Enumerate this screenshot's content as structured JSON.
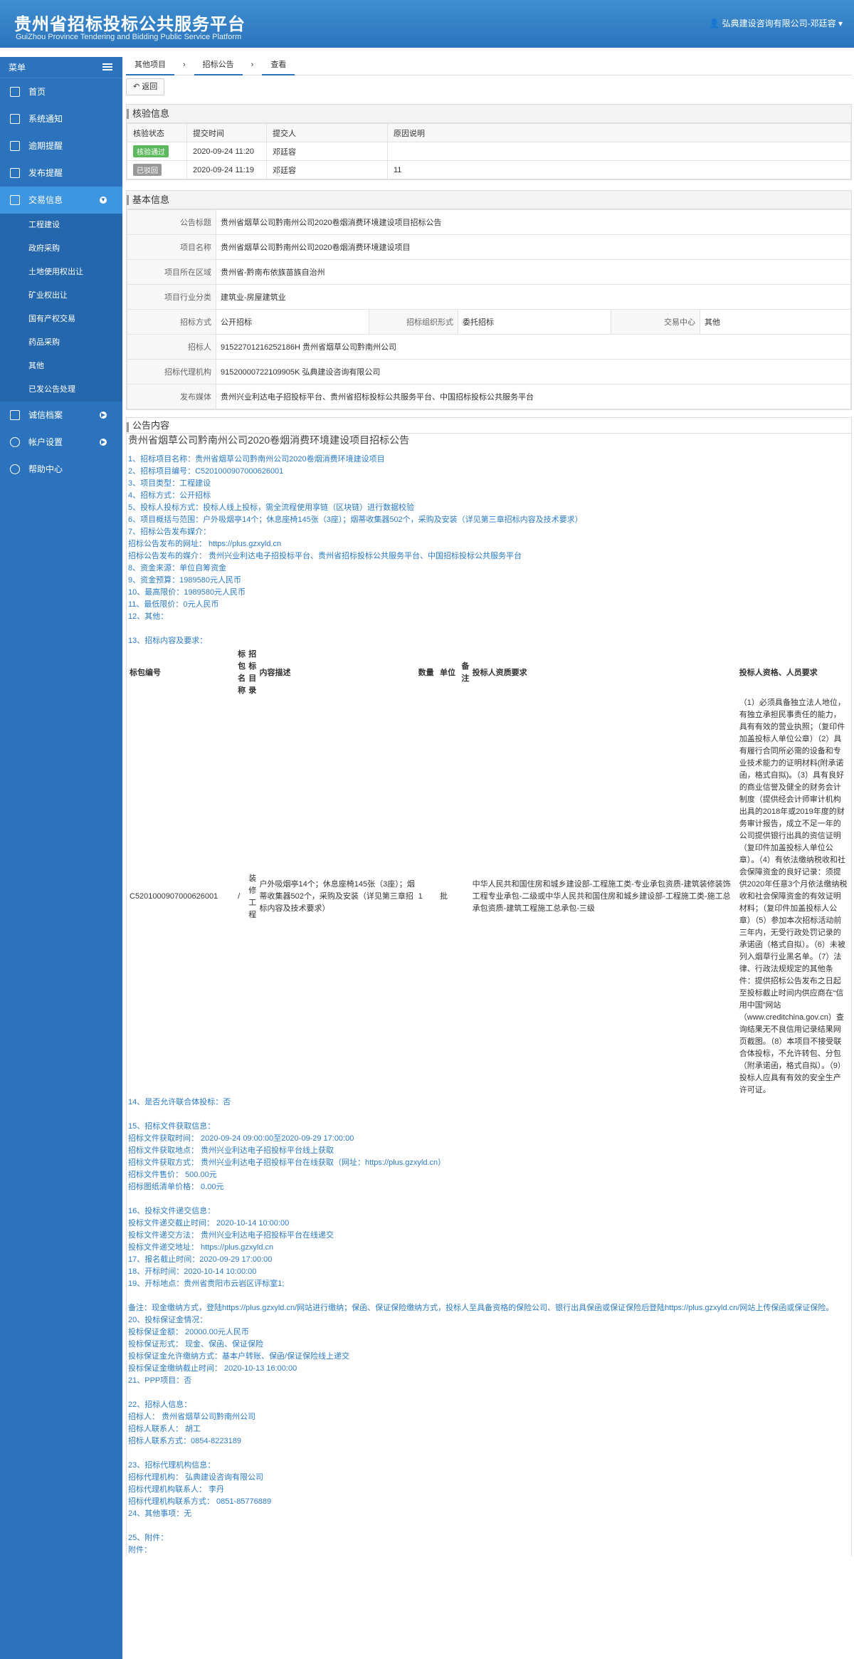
{
  "header": {
    "title_cn": "贵州省招标投标公共服务平台",
    "title_en": "GuiZhou Province Tendering and Bidding Public Service Platform",
    "user": "弘典建设咨询有限公司-邓廷容 ▾"
  },
  "sidebar": {
    "menu_label": "菜单",
    "items": [
      {
        "label": "首页",
        "icon": "home-icon"
      },
      {
        "label": "系统通知",
        "icon": "monitor-icon"
      },
      {
        "label": "逾期提醒",
        "icon": "clock-icon"
      },
      {
        "label": "发布提醒",
        "icon": "bell-icon"
      },
      {
        "label": "交易信息",
        "icon": "file-icon"
      }
    ],
    "sub_items": [
      "工程建设",
      "政府采购",
      "土地使用权出让",
      "矿业权出让",
      "国有产权交易",
      "药品采购",
      "其他",
      "已发公告处理"
    ],
    "bottom_items": [
      {
        "label": "诚信档案",
        "icon": "list-icon"
      },
      {
        "label": "帐户设置",
        "icon": "user-icon"
      },
      {
        "label": "帮助中心",
        "icon": "help-icon"
      }
    ]
  },
  "breadcrumb": [
    "其他项目",
    "招标公告",
    "查看"
  ],
  "back_label": "返回",
  "verify": {
    "title": "核验信息",
    "headers": [
      "核验状态",
      "提交时间",
      "提交人",
      "原因说明"
    ],
    "rows": [
      {
        "status": "核验通过",
        "status_color": "#5cb85c",
        "time": "2020-09-24 11:20",
        "person": "邓廷容",
        "reason": ""
      },
      {
        "status": "已驳回",
        "status_color": "#999999",
        "time": "2020-09-24 11:19",
        "person": "邓廷容",
        "reason": "11"
      }
    ]
  },
  "basic": {
    "title": "基本信息",
    "announce_title_label": "公告标题",
    "announce_title": "贵州省烟草公司黔南州公司2020卷烟消费环境建设项目招标公告",
    "project_label": "项目名称",
    "project": "贵州省烟草公司黔南州公司2020卷烟消费环境建设项目",
    "region_label": "项目所在区域",
    "region": "贵州省-黔南布依族苗族自治州",
    "industry_label": "项目行业分类",
    "industry": "建筑业-房屋建筑业",
    "method_label": "招标方式",
    "method": "公开招标",
    "org_label": "招标组织形式",
    "org": "委托招标",
    "center_label": "交易中心",
    "center": "其他",
    "tenderer_label": "招标人",
    "tenderer": "91522701216252186H 贵州省烟草公司黔南州公司",
    "agency_label": "招标代理机构",
    "agency": "91520000722109905K 弘典建设咨询有限公司",
    "media_label": "发布媒体",
    "media": "贵州兴业利达电子招投标平台、贵州省招标投标公共服务平台、中国招标投标公共服务平台"
  },
  "notice": {
    "section_title": "公告内容",
    "title": "贵州省烟草公司黔南州公司2020卷烟消费环境建设项目招标公告",
    "lines_a": [
      "1、招标项目名称：贵州省烟草公司黔南州公司2020卷烟消费环境建设项目",
      "2、招标项目编号：C5201000907000626001",
      "3、项目类型：工程建设",
      "4、招标方式：公开招标",
      "5、投标人投标方式：投标人线上投标，需全流程使用享链（区块链）进行数据校验",
      "6、项目概括与范围：户外吸烟亭14个；休息座椅145张（3座）；烟蒂收集器502个，采购及安装（详见第三章招标内容及技术要求）",
      "7、招标公告发布媒介：",
      "招标公告发布的网址： https://plus.gzxyld.cn",
      "招标公告发布的媒介： 贵州兴业利达电子招投标平台、贵州省招标投标公共服务平台、中国招标投标公共服务平台",
      "8、资金来源：单位自筹资金",
      "9、资金预算：1989580元人民币",
      "10、最高限价：1989580元人民币",
      "11、最低限价：0元人民币",
      "12、其他：",
      "",
      "13、招标内容及要求："
    ],
    "pkg_headers": [
      "标包编号",
      "标包名称",
      "招标目录",
      "内容描述",
      "数量",
      "单位",
      "备注",
      "投标人资质要求",
      "投标人资格、人员要求"
    ],
    "pkg_row": {
      "code": "C5201000907000626001",
      "name": "/",
      "catalog": "装修工程",
      "desc": "户外吸烟亭14个；休息座椅145张（3座）；烟蒂收集器502个，采购及安装（详见第三章招标内容及技术要求）",
      "qty": "1",
      "unit": "批",
      "remark": "",
      "qual": "中华人民共和国住房和城乡建设部-工程施工类-专业承包资质-建筑装修装饰工程专业承包-二级或中华人民共和国住房和城乡建设部-工程施工类-施工总承包资质-建筑工程施工总承包-三级",
      "staff": "（1）必须具备独立法人地位，有独立承担民事责任的能力，具有有效的营业执照；（复印件加盖投标人单位公章）（2）具有履行合同所必需的设备和专业技术能力的证明材料(附承诺函，格式自拟)。（3）具有良好的商业信誉及健全的财务会计制度（提供经会计师审计机构出具的2018年或2019年度的财务审计报告，成立不足一年的公司提供银行出具的资信证明（复印件加盖投标人单位公章）。（4）有依法缴纳税收和社会保障资金的良好记录：须提供2020年任意3个月依法缴纳税收和社会保障资金的有效证明材料；（复印件加盖投标人公章）（5）参加本次招标活动前三年内，无受行政处罚记录的承诺函（格式自拟）。（6）未被列入烟草行业黑名单。（7）法律、行政法规规定的其他条件：提供招标公告发布之日起至投标截止时间内供应商在“信用中国”网站（www.creditchina.gov.cn）查询结果无不良信用记录结果网页截图。（8）本项目不接受联合体投标，不允许转包、分包（附承诺函，格式自拟）。（9）投标人应具有有效的安全生产许可证。"
    },
    "lines_b": [
      "14、是否允许联合体投标：否",
      "",
      "15、招标文件获取信息：",
      "招标文件获取时间： 2020-09-24 09:00:00至2020-09-29 17:00:00",
      "招标文件获取地点： 贵州兴业利达电子招投标平台线上获取",
      "招标文件获取方式： 贵州兴业利达电子招投标平台在线获取（网址：https://plus.gzxyld.cn）",
      "招标文件售价： 500.00元",
      "招标图纸清单价格： 0.00元",
      "",
      "16、投标文件递交信息：",
      "投标文件递交截止时间： 2020-10-14 10:00:00",
      "投标文件递交方法： 贵州兴业利达电子招投标平台在线递交",
      "投标文件递交地址： https://plus.gzxyld.cn",
      "17、报名截止时间：2020-09-29 17:00:00",
      "18、开标时间：2020-10-14 10:00:00",
      "19、开标地点：贵州省贵阳市云岩区评标室1;",
      "",
      "备注：现金缴纳方式，登陆https://plus.gzxyld.cn/网站进行缴纳；保函、保证保险缴纳方式，投标人至具备资格的保险公司、银行出具保函或保证保险后登陆https://plus.gzxyld.cn/网站上传保函或保证保险。",
      "20、投标保证金情况：",
      "投标保证金额： 20000.00元人民币",
      "投标保证形式： 现金、保函、保证保险",
      "投标保证金允许缴纳方式：基本户转账、保函/保证保险线上递交",
      "投标保证金缴纳截止时间： 2020-10-13 16:00:00",
      "21、PPP项目：否",
      "",
      "22、招标人信息：",
      "招标人： 贵州省烟草公司黔南州公司",
      "招标人联系人： 胡工",
      "招标人联系方式：0854-8223189",
      "",
      "23、招标代理机构信息：",
      "招标代理机构： 弘典建设咨询有限公司",
      "招标代理机构联系人： 李丹",
      "招标代理机构联系方式： 0851-85776889",
      "24、其他事项：无",
      "",
      "25、附件：",
      "附件："
    ]
  }
}
